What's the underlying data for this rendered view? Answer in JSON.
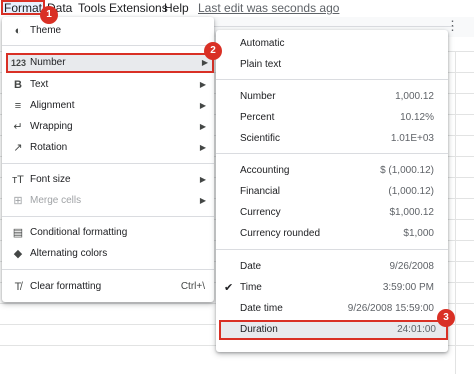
{
  "menubar": {
    "items": [
      "Format",
      "Data",
      "Tools",
      "Extensions",
      "Help"
    ],
    "last_edit": "Last edit was seconds ago"
  },
  "format_menu": {
    "items": {
      "theme": {
        "label": "Theme",
        "icon": "palette-icon"
      },
      "number": {
        "label": "Number",
        "icon": "123-icon"
      },
      "text": {
        "label": "Text",
        "icon": "bold-icon"
      },
      "alignment": {
        "label": "Alignment",
        "icon": "align-left-icon"
      },
      "wrapping": {
        "label": "Wrapping",
        "icon": "text-wrap-icon"
      },
      "rotation": {
        "label": "Rotation",
        "icon": "text-rotation-icon"
      },
      "font_size": {
        "label": "Font size",
        "icon": "font-size-icon"
      },
      "merge_cells": {
        "label": "Merge cells",
        "icon": "merge-icon"
      },
      "conditional_formatting": {
        "label": "Conditional formatting",
        "icon": "conditional-format-icon"
      },
      "alternating_colors": {
        "label": "Alternating colors",
        "icon": "paint-bucket-icon"
      },
      "clear_formatting": {
        "label": "Clear formatting",
        "shortcut": "Ctrl+\\",
        "icon": "clear-format-icon"
      }
    }
  },
  "number_menu": {
    "automatic": "Automatic",
    "plain_text": "Plain text",
    "rows": [
      {
        "label": "Number",
        "value": "1,000.12"
      },
      {
        "label": "Percent",
        "value": "10.12%"
      },
      {
        "label": "Scientific",
        "value": "1.01E+03"
      },
      {
        "label": "Accounting",
        "value": "$ (1,000.12)"
      },
      {
        "label": "Financial",
        "value": "(1,000.12)"
      },
      {
        "label": "Currency",
        "value": "$1,000.12"
      },
      {
        "label": "Currency rounded",
        "value": "$1,000"
      },
      {
        "label": "Date",
        "value": "9/26/2008"
      },
      {
        "label": "Time",
        "value": "3:59:00 PM"
      },
      {
        "label": "Date time",
        "value": "9/26/2008 15:59:00"
      },
      {
        "label": "Duration",
        "value": "24:01:00"
      }
    ],
    "checked_item": "Time"
  },
  "badges": [
    "1",
    "2",
    "3"
  ],
  "colors": {
    "highlight_border": "#d93025",
    "badge": "#d93025"
  }
}
